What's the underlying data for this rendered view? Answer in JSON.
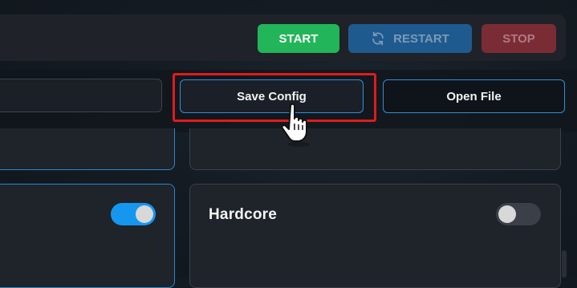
{
  "toolbar": {
    "start_label": "START",
    "restart_label": "RESTART",
    "stop_label": "STOP",
    "restart_icon": "refresh-icon"
  },
  "config": {
    "save_label": "Save Config",
    "open_label": "Open File"
  },
  "settings": {
    "hardcore_label": "Hardcore",
    "left_toggle_on": true,
    "hardcore_on": false
  },
  "colors": {
    "start": "#22b559",
    "restart": "#1f5a8e",
    "stop": "#7a2c35",
    "accent": "#2f8fd8",
    "highlight": "#e01b1b"
  },
  "cursor_icon": "hand-pointer-icon"
}
